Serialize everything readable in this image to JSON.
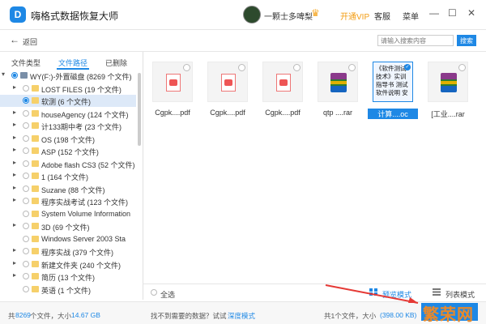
{
  "titlebar": {
    "app_title": "嗨格式数据恢复大师",
    "username": "一颗士多啤梨",
    "vip_label": "开通VIP",
    "service_label": "客服",
    "menu_label": "菜单",
    "minimize": "—",
    "maximize": "☐",
    "close": "✕"
  },
  "nav": {
    "back_label": "返回",
    "search_placeholder": "请输入搜索内容",
    "search_button": "搜索"
  },
  "tabs": [
    "文件类型",
    "文件路径",
    "已删除"
  ],
  "active_tab": "文件路径",
  "tree": [
    {
      "label": "WY(F:)-外置磁盘 (8269 个文件)",
      "expander": "▾",
      "drive": true,
      "state": "partial"
    },
    {
      "label": "LOST FILES (19 个文件)",
      "expander": "▸"
    },
    {
      "label": "软测 (6 个文件)",
      "expander": "",
      "selected": true,
      "state": "partial"
    },
    {
      "label": "houseAgency (124 个文件)",
      "expander": "▸"
    },
    {
      "label": "计133期中考 (23 个文件)",
      "expander": "▸"
    },
    {
      "label": "OS        (198 个文件)",
      "expander": "▸"
    },
    {
      "label": "ASP       (152 个文件)",
      "expander": "▸"
    },
    {
      "label": "Adobe flash CS3 (52 个文件)",
      "expander": "▸"
    },
    {
      "label": "1          (164 个文件)",
      "expander": "▸"
    },
    {
      "label": "Suzane (88 个文件)",
      "expander": "▸"
    },
    {
      "label": "程序实战考试 (123 个文件)",
      "expander": "▸"
    },
    {
      "label": "System Volume Information",
      "expander": ""
    },
    {
      "label": "3D        (69 个文件)",
      "expander": "▸"
    },
    {
      "label": "Windows Server 2003 Sta",
      "expander": ""
    },
    {
      "label": "程序实战 (379 个文件)",
      "expander": "▸"
    },
    {
      "label": "新建文件夹 (240 个文件)",
      "expander": "▸"
    },
    {
      "label": "简历 (13 个文件)",
      "expander": "▸"
    },
    {
      "label": "英语 (1 个文件)",
      "expander": ""
    }
  ],
  "files": [
    {
      "name": "Cgpk....pdf",
      "type": "pdf"
    },
    {
      "name": "Cgpk....pdf",
      "type": "pdf"
    },
    {
      "name": "Cgpk....pdf",
      "type": "pdf"
    },
    {
      "name": "qtp ....rar",
      "type": "rar"
    },
    {
      "name": "计算....oc",
      "type": "doc",
      "selected": true,
      "preview": "《软件测试技术》实训指导书 测试软件说明 安"
    },
    {
      "name": "[工业....rar",
      "type": "rar"
    }
  ],
  "bottombar": {
    "select_all": "全选",
    "preview_mode": "预览模式",
    "list_mode": "列表模式"
  },
  "status": {
    "total_prefix": "共",
    "total_count": "8269",
    "total_mid": "个文件，大小",
    "total_size": "14.67 GB",
    "hint": "找不到需要的数据？试试",
    "deep_scan": "深度模式",
    "selected_info": "共1个文件，大小",
    "selected_size": "(398.00 KB)"
  },
  "watermark": "繁荣网",
  "colors": {
    "accent": "#1e88e5",
    "vip": "#f39c12",
    "folder": "#f6d06a"
  }
}
